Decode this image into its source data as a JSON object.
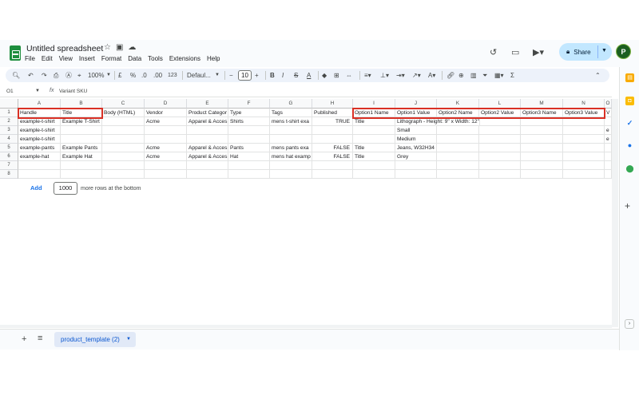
{
  "title": {
    "doc_name": "Untitled spreadsheet"
  },
  "menu": [
    "File",
    "Edit",
    "View",
    "Insert",
    "Format",
    "Data",
    "Tools",
    "Extensions",
    "Help"
  ],
  "share": {
    "label": "Share"
  },
  "user": {
    "initial": "P"
  },
  "toolbar": {
    "zoom": "100%",
    "currency": "£",
    "percent": "%",
    "dec_decrease": ".0",
    "dec_increase": ".00",
    "number_format": "123",
    "font": "Defaul...",
    "font_size": "10",
    "bold": "B",
    "sum": "Σ"
  },
  "formula_bar": {
    "cell_ref": "O1",
    "fx": "fx",
    "content": "Variant SKU"
  },
  "columns": [
    "A",
    "B",
    "C",
    "D",
    "E",
    "F",
    "G",
    "H",
    "I",
    "J",
    "K",
    "L",
    "M",
    "N",
    "O"
  ],
  "row_numbers": [
    "1",
    "2",
    "3",
    "4",
    "5",
    "6",
    "7",
    "8"
  ],
  "rows": [
    [
      "Handle",
      "Title",
      "Body (HTML)",
      "Vendor",
      "Product Categor",
      "Type",
      "Tags",
      "Published",
      "Option1 Name",
      "Option1 Value",
      "Option2 Name",
      "Option2 Value",
      "Option3 Name",
      "Option3 Value",
      "V"
    ],
    [
      "example-t-shirt",
      "Example T-Shirt",
      "",
      "Acme",
      "Apparel & Acces",
      "Shirts",
      "mens t-shirt exa",
      "TRUE",
      "Title",
      "Lithograph - Height: 9\" x Width: 12\"",
      "",
      "",
      "",
      "",
      ""
    ],
    [
      "example-t-shirt",
      "",
      "",
      "",
      "",
      "",
      "",
      "",
      "",
      "Small",
      "",
      "",
      "",
      "",
      "e"
    ],
    [
      "example-t-shirt",
      "",
      "",
      "",
      "",
      "",
      "",
      "",
      "",
      "Medium",
      "",
      "",
      "",
      "",
      "e"
    ],
    [
      "example-pants",
      "Example Pants",
      "",
      "Acme",
      "Apparel & Acces",
      "Pants",
      "mens pants exa",
      "FALSE",
      "Title",
      "Jeans, W32H34",
      "",
      "",
      "",
      "",
      ""
    ],
    [
      "example-hat",
      "Example Hat",
      "",
      "Acme",
      "Apparel & Acces",
      "Hat",
      "mens hat examp",
      "FALSE",
      "Title",
      "Grey",
      "",
      "",
      "",
      "",
      ""
    ],
    [
      "",
      "",
      "",
      "",
      "",
      "",
      "",
      "",
      "",
      "",
      "",
      "",
      "",
      "",
      ""
    ],
    [
      "",
      "",
      "",
      "",
      "",
      "",
      "",
      "",
      "",
      "",
      "",
      "",
      "",
      "",
      ""
    ]
  ],
  "add_rows": {
    "button": "Add",
    "count": "1000",
    "suffix": "more rows at the bottom"
  },
  "sheet_tab": {
    "name": "product_template (2)"
  }
}
